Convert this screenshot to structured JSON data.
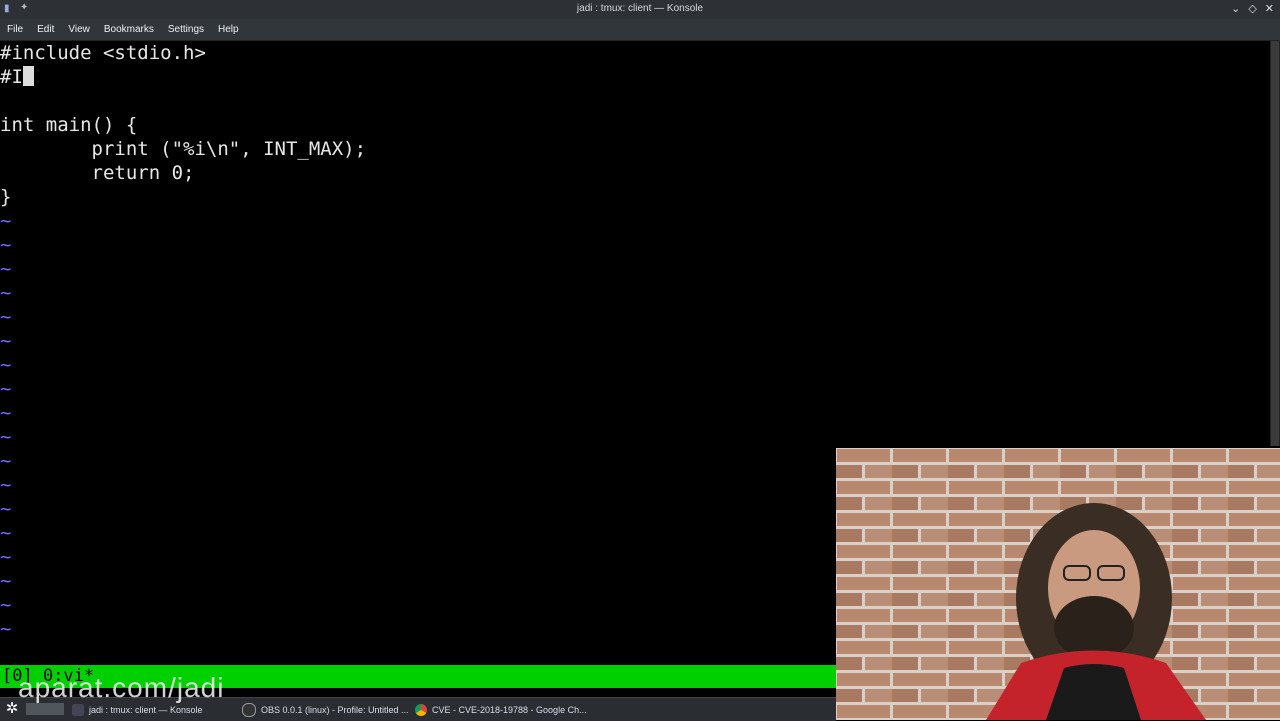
{
  "window": {
    "title": "jadi : tmux: client — Konsole"
  },
  "menu": [
    "File",
    "Edit",
    "View",
    "Bookmarks",
    "Settings",
    "Help"
  ],
  "editor": {
    "lines": [
      "#include <stdio.h>",
      "#I",
      "",
      "int main() {",
      "        print (\"%i\\n\", INT_MAX);",
      "        return 0;",
      "}"
    ],
    "tilde": "~",
    "empty_line_count": 18
  },
  "tmux": {
    "status": "[0] 0:vi*"
  },
  "watermark": "aparat.com/jadi",
  "taskbar": {
    "items": [
      {
        "label": "jadi : tmux: client — Konsole",
        "icon": "terminal-icon"
      },
      {
        "label": "OBS 0.0.1 (linux) - Profile: Untitled ...",
        "icon": "obs-icon"
      },
      {
        "label": "CVE - CVE-2018-19788 - Google Ch...",
        "icon": "chrome-icon"
      }
    ]
  },
  "colors": {
    "tmux_status": "#00d000",
    "tilde": "#6c6cff",
    "titlebar": "#2d3136"
  }
}
